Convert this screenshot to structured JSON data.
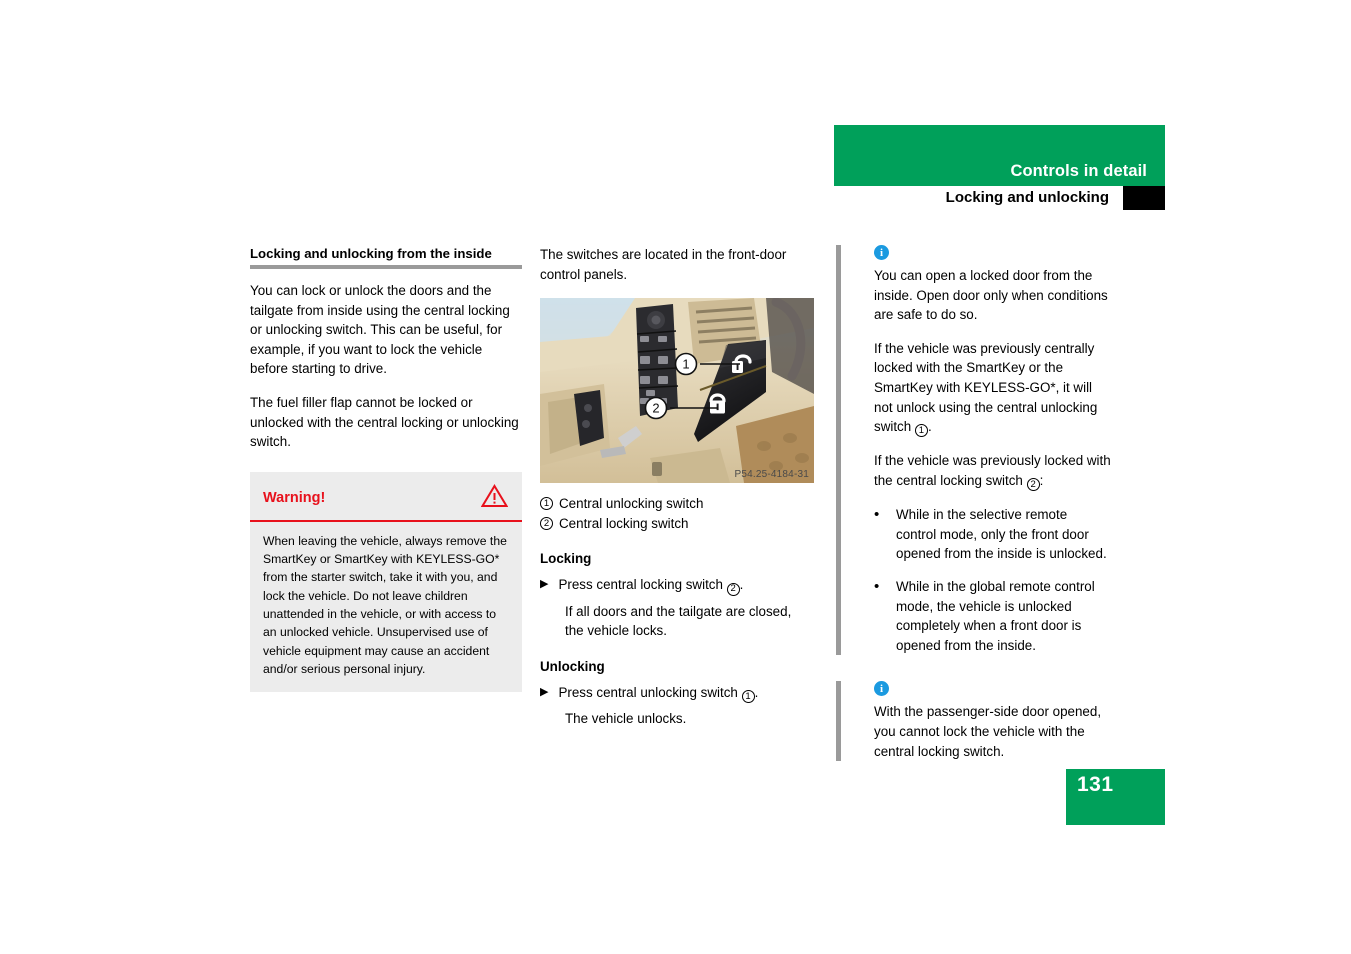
{
  "header": {
    "title": "Controls in detail",
    "subtitle": "Locking and unlocking",
    "green": "#00a05a"
  },
  "page_number": "131",
  "left_column": {
    "section_heading": "Locking and unlocking from the inside",
    "paragraphs": [
      "You can lock or unlock the doors and the tailgate from inside using the central locking or unlocking switch. This can be useful, for example, if you want to lock the vehicle before starting to drive.",
      "The fuel filler flap cannot be locked or unlocked with the central locking or unlocking switch."
    ],
    "warning": {
      "title": "Warning!",
      "icon": "warning-triangle-icon",
      "accent": "#e8111c",
      "body": "When leaving the vehicle, always remove the SmartKey or SmartKey with KEYLESS-GO* from the starter switch, take it with you, and lock the vehicle. Do not leave children unattended in the vehicle, or with access to an unlocked vehicle. Unsupervised use of vehicle equipment may cause an accident and/or serious personal injury."
    }
  },
  "middle_column": {
    "intro": "The switches are located in the front-door control panels.",
    "figure": {
      "id_label": "P54.25-4184-31",
      "callouts": [
        {
          "number": "1",
          "target": "central-unlocking-switch"
        },
        {
          "number": "2",
          "target": "central-locking-switch"
        }
      ]
    },
    "legend": [
      {
        "number": "1",
        "label": "Central unlocking switch"
      },
      {
        "number": "2",
        "label": "Central locking switch"
      }
    ],
    "locking": {
      "heading": "Locking",
      "step": "Press central locking switch",
      "step_ref": "2",
      "step_suffix": ".",
      "result": "If all doors and the tailgate are closed, the vehicle locks."
    },
    "unlocking": {
      "heading": "Unlocking",
      "step": "Press central unlocking switch",
      "step_ref": "1",
      "step_suffix": ".",
      "result": "The vehicle unlocks."
    }
  },
  "right_column": {
    "info_blocks": [
      {
        "icon": "info-icon",
        "paragraphs": [
          "You can open a locked door from the inside. Open door only when conditions are safe to do so."
        ],
        "paragraph_with_ref": {
          "before": "If the vehicle was previously centrally locked with the SmartKey or the SmartKey with KEYLESS-GO*, it will not unlock using the central unlocking switch",
          "ref": "1",
          "after": "."
        },
        "lead_in": {
          "before": "If the vehicle was previously locked with the central locking switch",
          "ref": "2",
          "after": ":"
        },
        "bullets": [
          "While in the selective remote control mode, only the front door opened from the inside is unlocked.",
          "While in the global remote control mode, the vehicle is unlocked completely when a front door is opened from the inside."
        ]
      },
      {
        "icon": "info-icon",
        "paragraphs": [
          "With the passenger-side door opened, you cannot lock the vehicle with the central locking switch."
        ]
      }
    ]
  }
}
